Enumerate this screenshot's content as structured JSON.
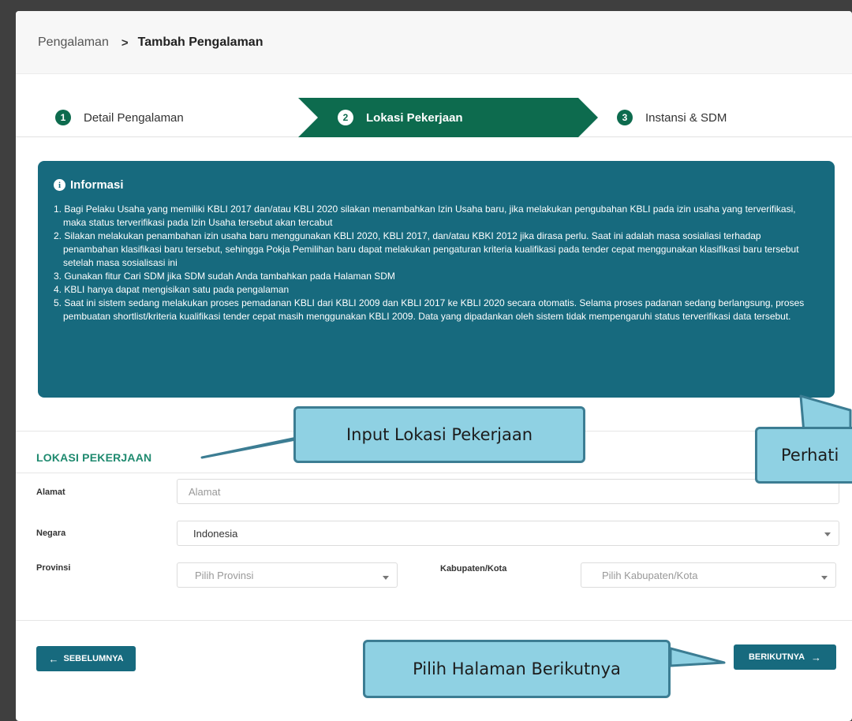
{
  "breadcrumb": {
    "parent": "Pengalaman",
    "separator": ">",
    "current": "Tambah Pengalaman"
  },
  "steps": [
    {
      "number": "1",
      "label": "Detail Pengalaman"
    },
    {
      "number": "2",
      "label": "Lokasi Pekerjaan"
    },
    {
      "number": "3",
      "label": "Instansi & SDM"
    }
  ],
  "info": {
    "title": "Informasi",
    "items": [
      "1. Bagi Pelaku Usaha yang memiliki KBLI 2017 dan/atau KBLI 2020 silakan menambahkan Izin Usaha baru, jika melakukan pengubahan KBLI pada izin usaha yang terverifikasi, maka status terverifikasi pada Izin Usaha tersebut akan tercabut",
      "2. Silakan melakukan penambahan izin usaha baru menggunakan KBLI 2020, KBLI 2017, dan/atau KBKI 2012 jika dirasa perlu. Saat ini adalah masa sosialiasi terhadap penambahan klasifikasi baru tersebut, sehingga Pokja Pemilihan baru dapat melakukan pengaturan kriteria kualifikasi pada tender cepat menggunakan klasifikasi baru tersebut setelah masa sosialisasi ini",
      "3. Gunakan fitur Cari SDM jika SDM sudah Anda tambahkan pada Halaman SDM",
      "4. KBLI hanya dapat mengisikan satu pada pengalaman",
      "5. Saat ini sistem sedang melakukan proses pemadanan KBLI dari KBLI 2009 dan KBLI 2017 ke KBLI 2020 secara otomatis. Selama proses padanan sedang berlangsung, proses pembuatan shortlist/kriteria kualifikasi tender cepat masih menggunakan KBLI 2009. Data yang dipadankan oleh sistem tidak mempengaruhi status terverifikasi data tersebut."
    ]
  },
  "form": {
    "section_title": "LOKASI PEKERJAAN",
    "alamat_label": "Alamat",
    "alamat_placeholder": "Alamat",
    "negara_label": "Negara",
    "negara_value": "Indonesia",
    "provinsi_label": "Provinsi",
    "provinsi_placeholder": "Pilih Provinsi",
    "kabupaten_label": "Kabupaten/Kota",
    "kabupaten_placeholder": "Pilih Kabupaten/Kota"
  },
  "buttons": {
    "prev_label": "SEBELUMNYA",
    "next_label": "BERIKUTNYA"
  },
  "callouts": {
    "input_lokasi": "Input Lokasi Pekerjaan",
    "perhatikan": "Perhati",
    "berikutnya": "Pilih Halaman Berikutnya"
  },
  "colors": {
    "primary_green": "#0d6b4e",
    "teal": "#176a7e",
    "section_green": "#1f8a6f",
    "callout_fill": "#8fd1e3"
  }
}
